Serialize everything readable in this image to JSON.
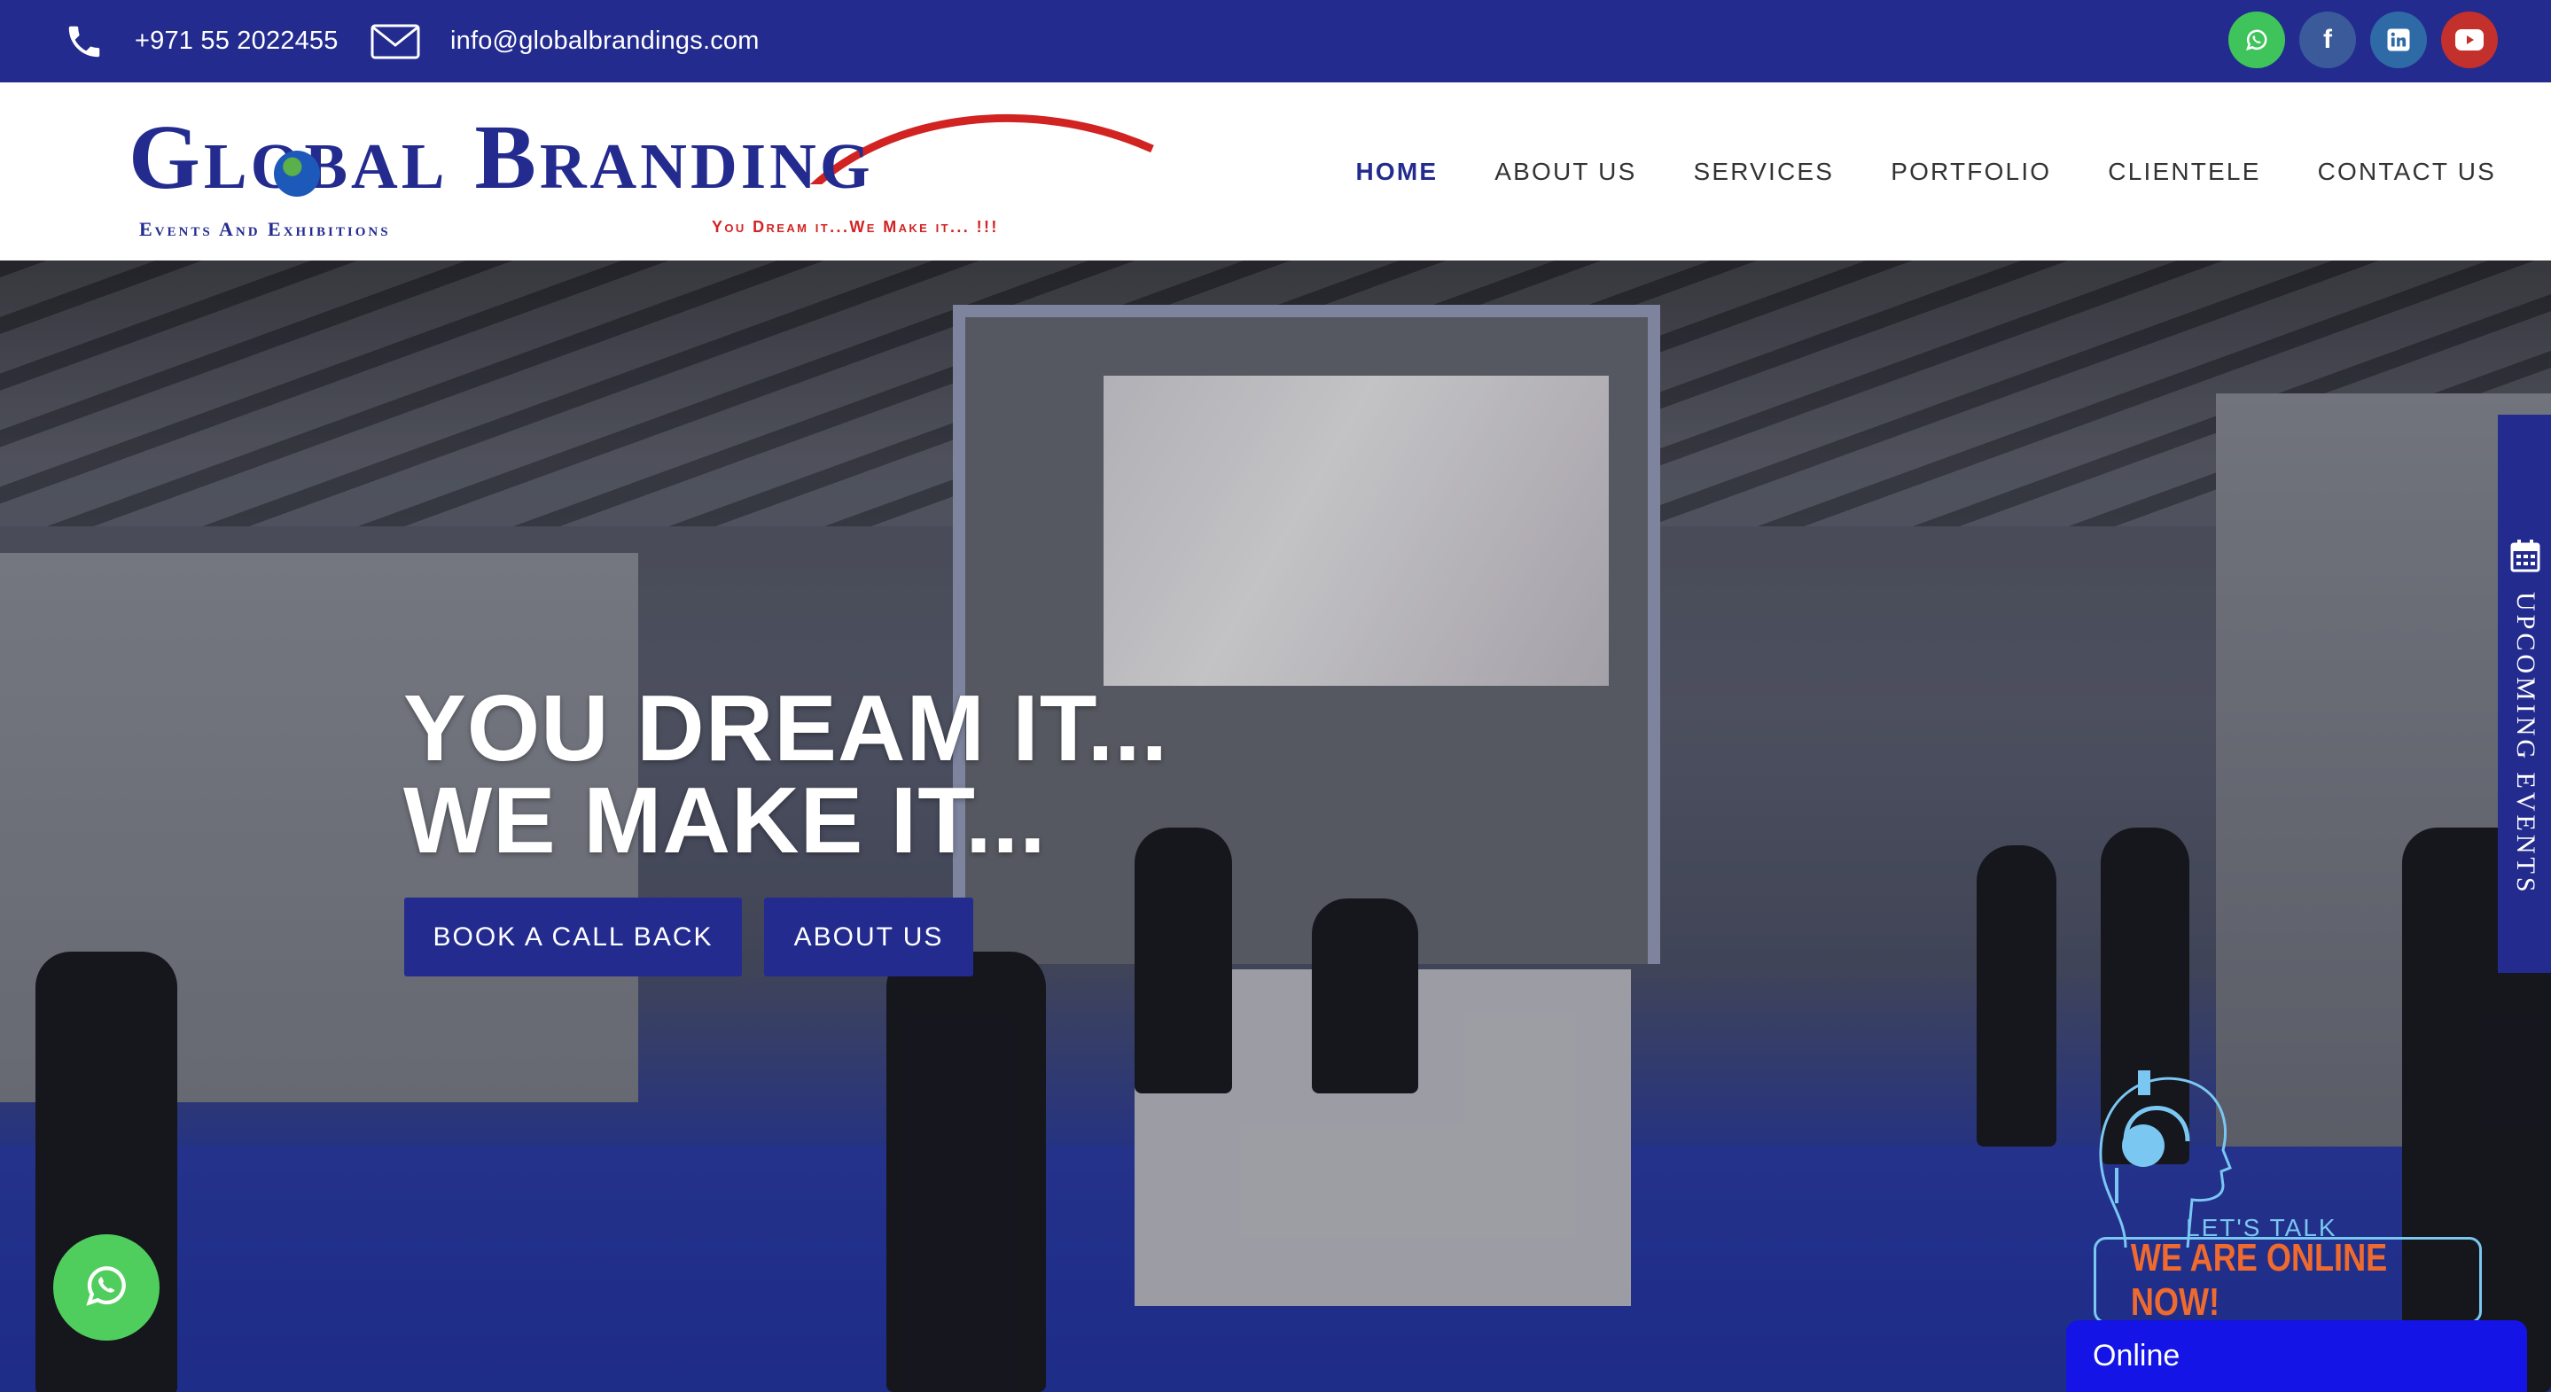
{
  "topbar": {
    "phone": "+971 55 2022455",
    "email": "info@globalbrandings.com",
    "socials": [
      {
        "name": "whatsapp",
        "icon": "whatsapp-icon",
        "color": "#3ec45a"
      },
      {
        "name": "facebook",
        "icon": "facebook-icon",
        "glyph": "f",
        "color": "#3b5a9a"
      },
      {
        "name": "linkedin",
        "icon": "linkedin-icon",
        "glyph": "in",
        "color": "#2e6aa6"
      },
      {
        "name": "youtube",
        "icon": "youtube-icon",
        "color": "#c4302b"
      }
    ]
  },
  "brand": {
    "name": "Global Branding",
    "subtitle": "Events And Exhibitions",
    "tagline": "You Dream it...We Make it... !!!"
  },
  "nav": {
    "items": [
      {
        "label": "HOME",
        "active": true
      },
      {
        "label": "ABOUT US",
        "active": false
      },
      {
        "label": "SERVICES",
        "active": false
      },
      {
        "label": "PORTFOLIO",
        "active": false
      },
      {
        "label": "CLIENTELE",
        "active": false
      },
      {
        "label": "CONTACT US",
        "active": false
      }
    ]
  },
  "hero": {
    "headline_line1": "YOU DREAM IT...",
    "headline_line2": "WE MAKE IT...",
    "cta_primary": "BOOK A CALL BACK",
    "cta_secondary": "ABOUT US"
  },
  "side_tab": {
    "label": "UPCOMING EVENTS",
    "icon": "calendar-icon"
  },
  "chat": {
    "lets_talk": "LET'S TALK",
    "online_now": "WE ARE ONLINE NOW!",
    "status": "Online"
  },
  "colors": {
    "brand_blue": "#232b8f",
    "accent_red": "#d22323",
    "whatsapp_green": "#4fce5d",
    "chat_orange": "#ef6a2e",
    "chat_bar": "#1414e6"
  }
}
